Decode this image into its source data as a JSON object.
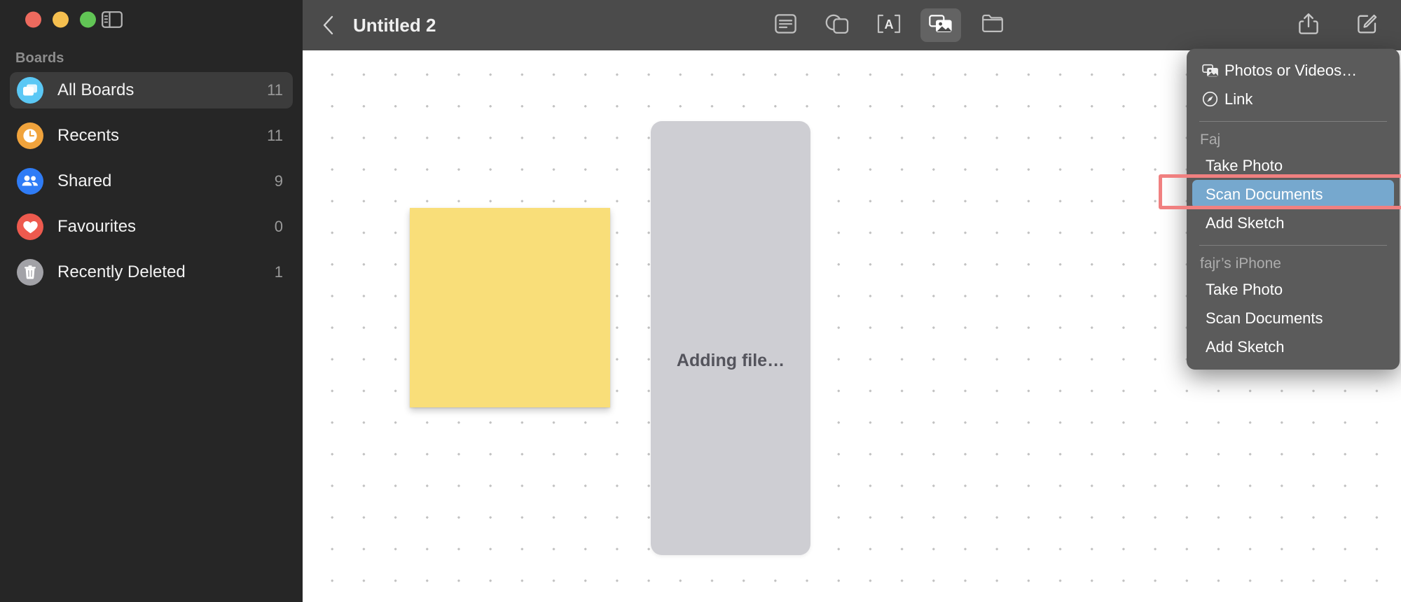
{
  "window": {
    "traffic_lights": [
      {
        "name": "close",
        "color": "#ED6A5E"
      },
      {
        "name": "minimize",
        "color": "#F5BF4F"
      },
      {
        "name": "zoom",
        "color": "#61C555"
      }
    ],
    "sidebar_toggle_tooltip": "Hide Sidebar"
  },
  "sidebar": {
    "section_label": "Boards",
    "items": [
      {
        "label": "All Boards",
        "count": "11",
        "icon": "all-boards-icon",
        "color": "#5BC8F5",
        "selected": true
      },
      {
        "label": "Recents",
        "count": "11",
        "icon": "clock-icon",
        "color": "#F0A33C",
        "selected": false
      },
      {
        "label": "Shared",
        "count": "9",
        "icon": "people-icon",
        "color": "#2F7CF6",
        "selected": false
      },
      {
        "label": "Favourites",
        "count": "0",
        "icon": "heart-icon",
        "color": "#ED5A4E",
        "selected": false
      },
      {
        "label": "Recently Deleted",
        "count": "1",
        "icon": "trash-icon",
        "color": "#A2A2A7",
        "selected": false
      }
    ]
  },
  "toolbar": {
    "back_label": "Back",
    "title": "Untitled 2",
    "tools": [
      {
        "name": "sticky-note-icon",
        "label": "Sticky Note",
        "active": false
      },
      {
        "name": "shapes-icon",
        "label": "Shapes",
        "active": false
      },
      {
        "name": "text-box-icon",
        "label": "Text Box",
        "active": false
      },
      {
        "name": "media-icon",
        "label": "Media",
        "active": true
      },
      {
        "name": "insert-file-icon",
        "label": "Insert File",
        "active": false
      }
    ],
    "right_tools": [
      {
        "name": "share-icon",
        "label": "Share"
      },
      {
        "name": "compose-icon",
        "label": "New Board"
      }
    ]
  },
  "menu": {
    "top_items": [
      {
        "label": "Photos or Videos…",
        "icon": "photos-icon",
        "highlighted": false
      },
      {
        "label": "Link",
        "icon": "link-compass-icon",
        "highlighted": false
      }
    ],
    "groups": [
      {
        "title": "Faj",
        "items": [
          {
            "label": "Take Photo",
            "highlighted": false
          },
          {
            "label": "Scan Documents",
            "highlighted": true
          },
          {
            "label": "Add Sketch",
            "highlighted": false
          }
        ]
      },
      {
        "title": "fajr’s iPhone",
        "items": [
          {
            "label": "Take Photo",
            "highlighted": false
          },
          {
            "label": "Scan Documents",
            "highlighted": false
          },
          {
            "label": "Add Sketch",
            "highlighted": false
          }
        ]
      }
    ],
    "highlight_color": "#76A8CE"
  },
  "canvas": {
    "sticky_note_color": "#F9DE79",
    "file_placeholder_label": "Adding file…"
  },
  "annotation": {
    "target": "Scan Documents",
    "color": "#F08080"
  }
}
